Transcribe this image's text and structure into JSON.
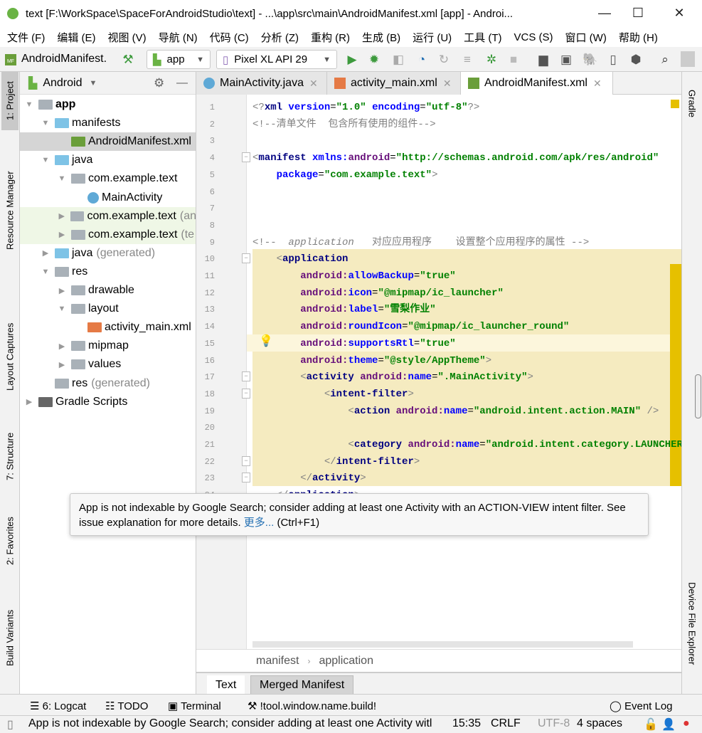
{
  "window": {
    "title": "text [F:\\WorkSpace\\SpaceForAndroidStudio\\text] - ...\\app\\src\\main\\AndroidManifest.xml [app] - Androi...",
    "minimize": "—",
    "maximize": "☐",
    "close": "✕"
  },
  "menu": [
    "文件 (F)",
    "编辑 (E)",
    "视图 (V)",
    "导航 (N)",
    "代码 (C)",
    "分析 (Z)",
    "重构 (R)",
    "生成 (B)",
    "运行 (U)",
    "工具 (T)",
    "VCS (S)",
    "窗口 (W)",
    "帮助 (H)"
  ],
  "toolbar": {
    "file": "AndroidManifest.",
    "module": "app",
    "device": "Pixel XL API 29"
  },
  "left_tools": [
    "1: Project",
    "Resource Manager",
    "Layout Captures",
    "7: Structure",
    "2: Favorites",
    "Build Variants"
  ],
  "right_tools": [
    "Gradle",
    "Device File Explorer"
  ],
  "project": {
    "view": "Android",
    "tree": [
      {
        "label": "app",
        "depth": 0,
        "arrow": "down",
        "bold": true,
        "icon": "module"
      },
      {
        "label": "manifests",
        "depth": 1,
        "arrow": "down",
        "icon": "folder-blue"
      },
      {
        "label": "AndroidManifest.xml",
        "depth": 2,
        "icon": "manifest",
        "selected": true
      },
      {
        "label": "java",
        "depth": 1,
        "arrow": "down",
        "icon": "folder-blue"
      },
      {
        "label": "com.example.text",
        "depth": 2,
        "arrow": "down",
        "icon": "package"
      },
      {
        "label": "MainActivity",
        "depth": 3,
        "icon": "class"
      },
      {
        "label": "com.example.text",
        "suffix": "(an",
        "depth": 2,
        "arrow": "right",
        "icon": "package",
        "green": true
      },
      {
        "label": "com.example.text",
        "suffix": "(te",
        "depth": 2,
        "arrow": "right",
        "icon": "package",
        "green": true
      },
      {
        "label": "java",
        "suffix": "(generated)",
        "depth": 1,
        "arrow": "right",
        "icon": "folder-gen"
      },
      {
        "label": "res",
        "depth": 1,
        "arrow": "down",
        "icon": "folder-res"
      },
      {
        "label": "drawable",
        "depth": 2,
        "arrow": "right",
        "icon": "package"
      },
      {
        "label": "layout",
        "depth": 2,
        "arrow": "down",
        "icon": "package"
      },
      {
        "label": "activity_main.xml",
        "depth": 3,
        "icon": "layout-xml"
      },
      {
        "label": "mipmap",
        "depth": 2,
        "arrow": "right",
        "icon": "package"
      },
      {
        "label": "values",
        "depth": 2,
        "arrow": "right",
        "icon": "package"
      },
      {
        "label": "res",
        "suffix": "(generated)",
        "depth": 1,
        "icon": "folder-res"
      },
      {
        "label": "Gradle Scripts",
        "depth": 0,
        "arrow": "right",
        "icon": "gradle"
      }
    ]
  },
  "tabs": [
    {
      "label": "MainActivity.java",
      "icon": "class"
    },
    {
      "label": "activity_main.xml",
      "icon": "layout-xml"
    },
    {
      "label": "AndroidManifest.xml",
      "icon": "manifest",
      "active": true
    }
  ],
  "code": [
    [
      [
        "cm",
        "<?"
      ],
      [
        "tag",
        "xml "
      ],
      [
        "attr",
        "version"
      ],
      [
        "pl",
        "="
      ],
      [
        "val",
        "\"1.0\""
      ],
      [
        "pl",
        " "
      ],
      [
        "attr",
        "encoding"
      ],
      [
        "pl",
        "="
      ],
      [
        "val",
        "\"utf-8\""
      ],
      [
        "cm",
        "?>"
      ]
    ],
    [
      [
        "cm",
        "<!--清单文件  包含所有使用的组件-->"
      ]
    ],
    [],
    [
      [
        "cm",
        "<"
      ],
      [
        "tag",
        "manifest "
      ],
      [
        "attr",
        "xmlns:"
      ],
      [
        "ns",
        "android"
      ],
      [
        "pl",
        "="
      ],
      [
        "val",
        "\"http://schemas.android.com/apk/res/android\""
      ]
    ],
    [
      [
        "pl",
        "    "
      ],
      [
        "attr",
        "package"
      ],
      [
        "pl",
        "="
      ],
      [
        "val",
        "\"com.example.text\""
      ],
      [
        "cm",
        ">"
      ]
    ],
    [],
    [],
    [],
    [
      [
        "cm",
        "<!--  "
      ],
      [
        "cmi",
        "application"
      ],
      [
        "cm",
        "   对应应用程序    设置整个应用程序的属性 -->"
      ]
    ],
    [
      [
        "pl",
        "    "
      ],
      [
        "cm",
        "<"
      ],
      [
        "tag",
        "application"
      ]
    ],
    [
      [
        "pl",
        "        "
      ],
      [
        "ns",
        "android:"
      ],
      [
        "attr",
        "allowBackup"
      ],
      [
        "pl",
        "="
      ],
      [
        "val",
        "\"true\""
      ]
    ],
    [
      [
        "pl",
        "        "
      ],
      [
        "ns",
        "android:"
      ],
      [
        "attr",
        "icon"
      ],
      [
        "pl",
        "="
      ],
      [
        "val",
        "\"@mipmap/ic_launcher\""
      ]
    ],
    [
      [
        "pl",
        "        "
      ],
      [
        "ns",
        "android:"
      ],
      [
        "attr",
        "label"
      ],
      [
        "pl",
        "="
      ],
      [
        "val",
        "\"雪梨作业\""
      ]
    ],
    [
      [
        "pl",
        "        "
      ],
      [
        "ns",
        "android:"
      ],
      [
        "attr",
        "roundIcon"
      ],
      [
        "pl",
        "="
      ],
      [
        "val",
        "\"@mipmap/ic_launcher_round\""
      ]
    ],
    [
      [
        "pl",
        "        "
      ],
      [
        "ns",
        "android:"
      ],
      [
        "attr",
        "supportsRtl"
      ],
      [
        "pl",
        "="
      ],
      [
        "val",
        "\"true\""
      ]
    ],
    [
      [
        "pl",
        "        "
      ],
      [
        "ns",
        "android:"
      ],
      [
        "attr",
        "theme"
      ],
      [
        "pl",
        "="
      ],
      [
        "val",
        "\"@style/AppTheme\""
      ],
      [
        "cm",
        ">"
      ]
    ],
    [
      [
        "pl",
        "        "
      ],
      [
        "cm",
        "<"
      ],
      [
        "tag",
        "activity "
      ],
      [
        "ns",
        "android:"
      ],
      [
        "attr",
        "name"
      ],
      [
        "pl",
        "="
      ],
      [
        "val",
        "\".MainActivity\""
      ],
      [
        "cm",
        ">"
      ]
    ],
    [
      [
        "pl",
        "            "
      ],
      [
        "cm",
        "<"
      ],
      [
        "tag",
        "intent-filter"
      ],
      [
        "cm",
        ">"
      ]
    ],
    [
      [
        "pl",
        "                "
      ],
      [
        "cm",
        "<"
      ],
      [
        "tag",
        "action "
      ],
      [
        "ns",
        "android:"
      ],
      [
        "attr",
        "name"
      ],
      [
        "pl",
        "="
      ],
      [
        "val",
        "\"android.intent.action.MAIN\""
      ],
      [
        "cm",
        " />"
      ]
    ],
    [],
    [
      [
        "pl",
        "                "
      ],
      [
        "cm",
        "<"
      ],
      [
        "tag",
        "category "
      ],
      [
        "ns",
        "android:"
      ],
      [
        "attr",
        "name"
      ],
      [
        "pl",
        "="
      ],
      [
        "val",
        "\"android.intent.category.LAUNCHER\""
      ]
    ],
    [
      [
        "pl",
        "            "
      ],
      [
        "cm",
        "</"
      ],
      [
        "tag",
        "intent-filter"
      ],
      [
        "cm",
        ">"
      ]
    ],
    [
      [
        "pl",
        "        "
      ],
      [
        "cm",
        "</"
      ],
      [
        "tag",
        "activity"
      ],
      [
        "cm",
        ">"
      ]
    ],
    [
      [
        "pl",
        "    "
      ],
      [
        "cm",
        "</"
      ],
      [
        "tag",
        "application"
      ],
      [
        "cm",
        ">"
      ]
    ]
  ],
  "tooltip": {
    "text": "App is not indexable by Google Search; consider adding at least one Activity with an ACTION-VIEW intent filter. See issue explanation for more details. ",
    "link": "更多...",
    "shortcut": " (Ctrl+F1)"
  },
  "breadcrumb": [
    "manifest",
    "application"
  ],
  "bottom_tabs": [
    "Text",
    "Merged Manifest"
  ],
  "tool_windows": {
    "logcat": "6: Logcat",
    "todo": "TODO",
    "terminal": "Terminal",
    "build": "!tool.window.name.build!",
    "event_log": "Event Log"
  },
  "status": {
    "message": "App is not indexable by Google Search; consider adding at least one Activity witl",
    "position": "15:35",
    "line_sep": "CRLF",
    "encoding": "UTF-8",
    "indent": "4 spaces"
  },
  "colors": {
    "highlight": "#f5ebc0",
    "warning_stripe": "#e6c000",
    "run_green": "#3d9a3d"
  }
}
